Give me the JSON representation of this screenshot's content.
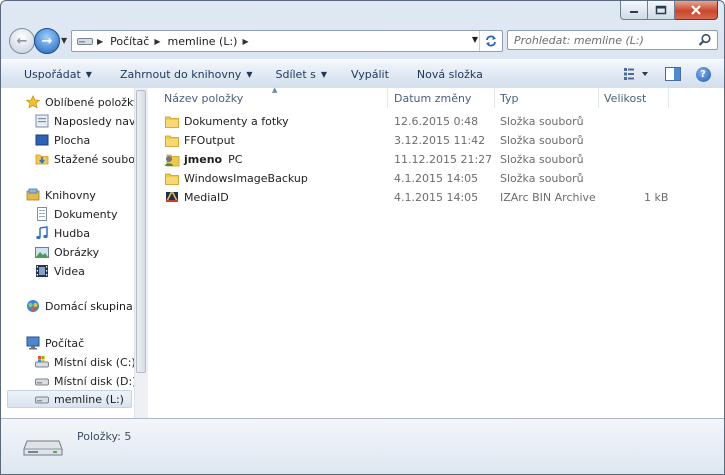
{
  "window": {
    "caption_buttons": [
      "minimize",
      "maximize",
      "close"
    ]
  },
  "address_bar": {
    "crumbs": [
      "Počítač",
      "memline (L:)"
    ]
  },
  "search": {
    "placeholder": "Prohledat: memline (L:)"
  },
  "toolbar": {
    "organize": "Uspořádat",
    "include_library": "Zahrnout do knihovny",
    "share": "Sdílet s",
    "burn": "Vypálit",
    "new_folder": "Nová složka"
  },
  "sidebar": {
    "favorites": {
      "header": "Oblíbené položky",
      "items": [
        "Naposledy navští",
        "Plocha",
        "Stažené soubory"
      ]
    },
    "libraries": {
      "header": "Knihovny",
      "items": [
        "Dokumenty",
        "Hudba",
        "Obrázky",
        "Videa"
      ]
    },
    "homegroup": {
      "header": "Domácí skupina"
    },
    "computer": {
      "header": "Počítač",
      "items": [
        "Místní disk (C:)",
        "Místní disk (D:)",
        "memline (L:)"
      ]
    }
  },
  "columns": {
    "name": "Název položky",
    "date": "Datum změny",
    "type": "Typ",
    "size": "Velikost"
  },
  "files": [
    {
      "name": "Dokumenty a fotky",
      "date": "12.6.2015 0:48",
      "type": "Složka souborů",
      "size": "",
      "icon": "folder-icon"
    },
    {
      "name": "FFOutput",
      "date": "3.12.2015 11:42",
      "type": "Složka souborů",
      "size": "",
      "icon": "folder-icon"
    },
    {
      "name_bold": "jmeno",
      "name_rest": "PC",
      "date": "11.12.2015 21:27",
      "type": "Složka souborů",
      "size": "",
      "icon": "user-folder-icon"
    },
    {
      "name": "WindowsImageBackup",
      "date": "4.1.2015 14:05",
      "type": "Složka souborů",
      "size": "",
      "icon": "folder-icon"
    },
    {
      "name": "MediaID",
      "date": "4.1.2015 14:05",
      "type": "IZArc BIN Archive",
      "size": "1 kB",
      "icon": "izarc-archive-icon"
    }
  ],
  "details": {
    "count": "Položky: 5"
  },
  "colors": {
    "folder": "#f2c94c",
    "selection": "#d9e4f1",
    "toolbar_text": "#1e395b"
  }
}
